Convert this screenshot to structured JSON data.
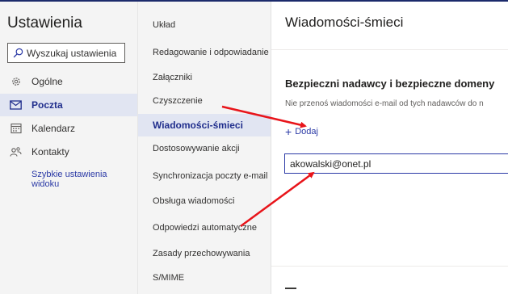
{
  "left_panel": {
    "title": "Ustawienia",
    "search_placeholder": "Wyszukaj ustawienia",
    "nav": [
      {
        "label": "Ogólne",
        "icon": "gear-icon"
      },
      {
        "label": "Poczta",
        "icon": "mail-icon"
      },
      {
        "label": "Kalendarz",
        "icon": "calendar-icon"
      },
      {
        "label": "Kontakty",
        "icon": "contacts-icon"
      }
    ],
    "quick_link": "Szybkie ustawienia widoku"
  },
  "middle_panel": {
    "items": [
      "Układ",
      "Redagowanie i odpowiadanie",
      "Załączniki",
      "Czyszczenie",
      "Wiadomości-śmieci",
      "Dostosowywanie akcji",
      "Synchronizacja poczty e-mail",
      "Obsługa wiadomości",
      "Odpowiedzi automatyczne",
      "Zasady przechowywania",
      "S/MIME"
    ]
  },
  "right_panel": {
    "title": "Wiadomości-śmieci",
    "section_title": "Bezpieczni nadawcy i bezpieczne domeny",
    "description": "Nie przenoś wiadomości e-mail od tych nadawców do n",
    "add_label": "Dodaj",
    "entry_value": "akowalski@onet.pl"
  },
  "colors": {
    "accent": "#2b3aa6",
    "active_bg": "#e1e5f2",
    "annotation_arrow": "#e8141a"
  }
}
